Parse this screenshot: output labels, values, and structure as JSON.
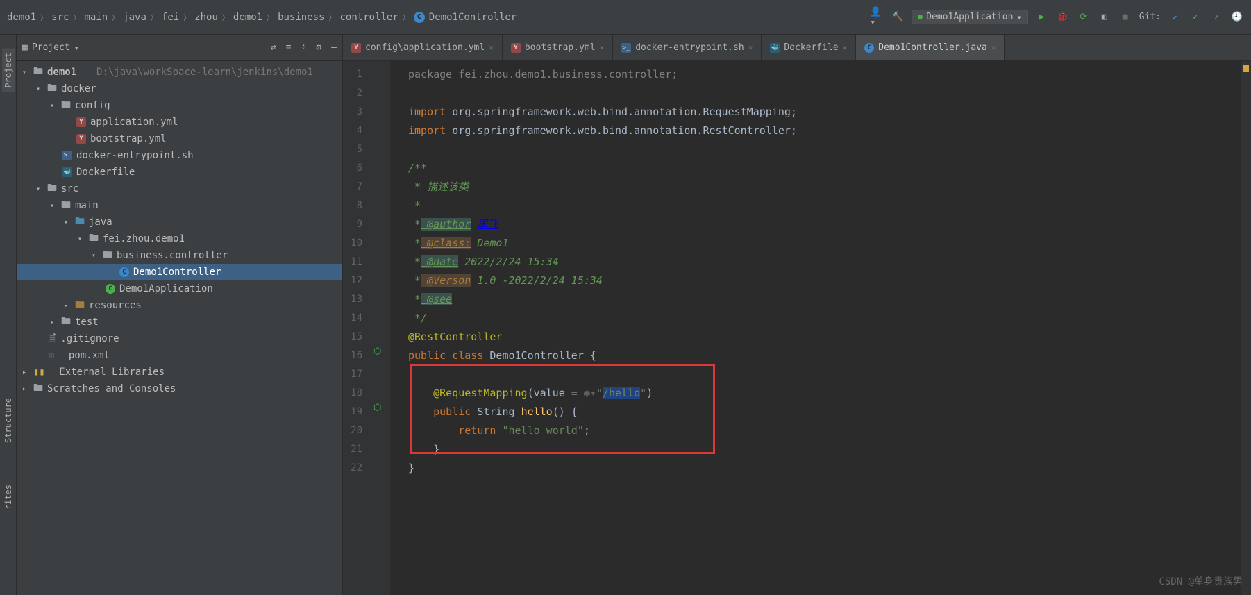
{
  "breadcrumb": [
    "demo1",
    "src",
    "main",
    "java",
    "fei",
    "zhou",
    "demo1",
    "business",
    "controller",
    "Demo1Controller"
  ],
  "runConfig": {
    "label": "Demo1Application"
  },
  "git_label": "Git:",
  "sideTabs": {
    "project": "Project",
    "structure": "Structure",
    "favorites": "rites"
  },
  "panel": {
    "title": "Project",
    "tree": {
      "root": {
        "name": "demo1",
        "path": "D:\\java\\workSpace-learn\\jenkins\\demo1"
      },
      "docker": "docker",
      "config": "config",
      "app_yml": "application.yml",
      "boot_yml": "bootstrap.yml",
      "entry_sh": "docker-entrypoint.sh",
      "dockerfile": "Dockerfile",
      "src": "src",
      "main": "main",
      "java": "java",
      "pkg": "fei.zhou.demo1",
      "bizctrl": "business.controller",
      "ctrl": "Demo1Controller",
      "app": "Demo1Application",
      "resources": "resources",
      "test": "test",
      "gitignore": ".gitignore",
      "pom": "pom.xml",
      "extlib": "External Libraries",
      "scratches": "Scratches and Consoles"
    }
  },
  "tabs": [
    {
      "label": "config\\application.yml",
      "icon": "yml"
    },
    {
      "label": "bootstrap.yml",
      "icon": "yml"
    },
    {
      "label": "docker-entrypoint.sh",
      "icon": "sh"
    },
    {
      "label": "Dockerfile",
      "icon": "docker"
    },
    {
      "label": "Demo1Controller.java",
      "icon": "java",
      "active": true
    }
  ],
  "code": {
    "package_line": "package fei.zhou.demo1.business.controller;",
    "import1_kw": "import ",
    "import1_pkg": "org.springframework.web.bind.annotation.",
    "import1_cls": "RequestMapping",
    "import2_cls": "RestController",
    "semi": ";",
    "jdoc_open": "/**",
    "jdoc_desc": " * 描述该类",
    "jdoc_star": " *",
    "jdoc_author": " * @author",
    "jdoc_author_txt": " <a href=\"920786312@qq.com\">周飞</a>",
    "jdoc_class": " * @class:",
    "jdoc_class_txt": " Demo1",
    "jdoc_date": " * @date",
    "jdoc_date_txt": " 2022/2/24 15:34",
    "jdoc_verson": " * @Verson",
    "jdoc_verson_txt": " 1.0 -2022/2/24 15:34",
    "jdoc_see": " * @see",
    "jdoc_close": " */",
    "ann_rest": "@RestController",
    "public": "public ",
    "class_kw": "class ",
    "ctrl_name": "Demo1Controller",
    "brace": " {",
    "ann_rm": "@RequestMapping",
    "rm_open": "(value = ",
    "rm_quote": "\"",
    "rm_path": "/hello",
    "rm_close": ")",
    "string_cls": "String ",
    "hello_m": "hello",
    "hello_parens": "() {",
    "return_kw": "return ",
    "hello_str": "\"hello world\"",
    "close_brace": "}"
  },
  "line_numbers": [
    1,
    2,
    3,
    4,
    5,
    6,
    7,
    8,
    9,
    10,
    11,
    12,
    13,
    14,
    15,
    16,
    17,
    18,
    19,
    20,
    21,
    22
  ],
  "watermark": "CSDN @单身贵族男"
}
